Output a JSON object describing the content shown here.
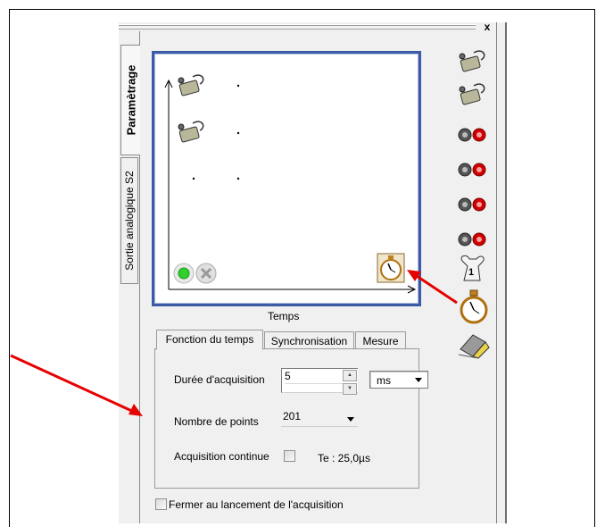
{
  "window": {
    "close_label": "x"
  },
  "side_tabs": {
    "parametrage": "Paramètrage",
    "sortie": "Sortie analogique S2"
  },
  "graph": {
    "x_axis_label": "Temps"
  },
  "tabs": [
    {
      "label": "Fonction du temps",
      "active": true
    },
    {
      "label": "Synchronisation",
      "active": false
    },
    {
      "label": "Mesure",
      "active": false
    }
  ],
  "form": {
    "duree_label": "Durée d'acquisition",
    "duree_value": "5",
    "unit_value": "ms",
    "points_label": "Nombre de points",
    "points_value": "201",
    "continue_label": "Acquisition continue",
    "te_text": "Te : 25,0µs"
  },
  "footer": {
    "fermer_label": "Fermer au lancement de l'acquisition"
  },
  "colors": {
    "graph_border": "#3c5aa6",
    "annotation_arrow": "#e60000",
    "go_button": "#2fd12f",
    "terminal_red": "#d00000"
  },
  "icons": {
    "sensor": "sensor-probe-icon",
    "terminal": "terminal-pair-icon",
    "timer": "stopwatch-icon",
    "trigger": "trigger-icon",
    "eraser": "eraser-icon"
  }
}
